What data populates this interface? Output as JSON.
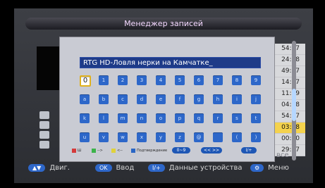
{
  "header": {
    "title": "Менеджер записей"
  },
  "records": {
    "times": [
      "54:57",
      "24:58",
      "49:17",
      "14:57",
      "11:09",
      "04:58",
      "54:57",
      "03:38",
      "00:00",
      "29:57"
    ],
    "selected_index": 7,
    "footer_label": "все"
  },
  "keyboard": {
    "input_value": "RTG HD-Ловля нерки на Камчатке_",
    "rows": [
      [
        "0",
        "1",
        "2",
        "3",
        "4",
        "5",
        "6",
        "7",
        "8",
        "9"
      ],
      [
        "a",
        "b",
        "c",
        "d",
        "e",
        "f",
        "g",
        "h",
        "i",
        "j"
      ],
      [
        "k",
        "l",
        "m",
        "n",
        "o",
        "p",
        "q",
        "r",
        "s",
        "t"
      ],
      [
        "u",
        "v",
        "w",
        "x",
        "y",
        "z",
        "@",
        "",
        "(",
        ")"
      ]
    ],
    "legend": [
      {
        "label": "Ш",
        "color": "#d43a3a"
      },
      {
        "label": "-->",
        "color": "#3cb34a"
      },
      {
        "label": "<--",
        "color": "#e0d23a"
      },
      {
        "label": "Подтверждение",
        "color": "#2a66c4"
      }
    ],
    "pills": [
      "0~9",
      "<<  >>",
      "I/+"
    ]
  },
  "footer": {
    "move": {
      "icon": "updown-icon",
      "label": "Двиг."
    },
    "ok": {
      "button": "OK",
      "label": "Ввод"
    },
    "info": {
      "button": "I/+",
      "label": "Данные устройства"
    },
    "menu": {
      "icon": "menu-icon",
      "label": "Меню"
    }
  }
}
